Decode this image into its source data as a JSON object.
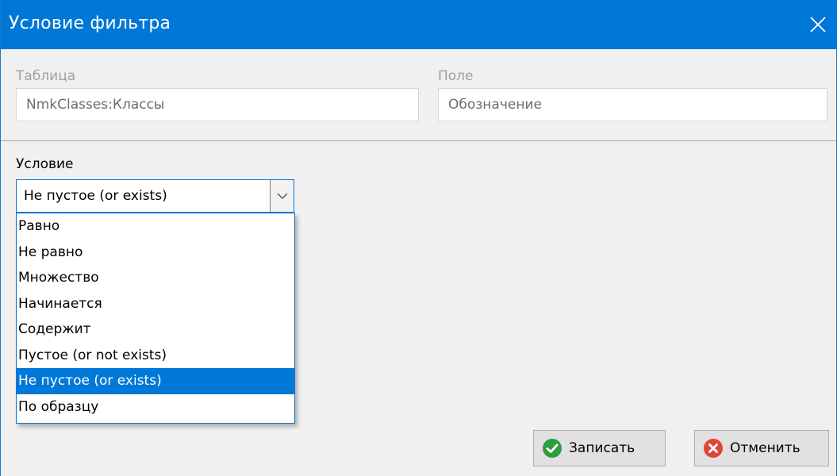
{
  "window": {
    "title": "Условие фильтра",
    "close_glyph": "✕"
  },
  "table_field": {
    "label": "Таблица",
    "value": "NmkClasses:Классы"
  },
  "field_field": {
    "label": "Поле",
    "value": "Обозначение"
  },
  "condition": {
    "label": "Условие",
    "selected": "Не пустое (or exists)",
    "options": [
      "Равно",
      "Не равно",
      "Множество",
      "Начинается",
      "Содержит",
      "Пустое (or not exists)",
      "Не пустое (or exists)",
      "По образцу"
    ],
    "highlighted_index": 6
  },
  "buttons": {
    "save_label": "Записать",
    "save_icon": "check-circle-icon",
    "cancel_label": "Отменить",
    "cancel_icon": "x-circle-icon"
  },
  "colors": {
    "accent": "#0078d7",
    "save_green": "#2e9e3c",
    "cancel_red": "#e0443c"
  }
}
